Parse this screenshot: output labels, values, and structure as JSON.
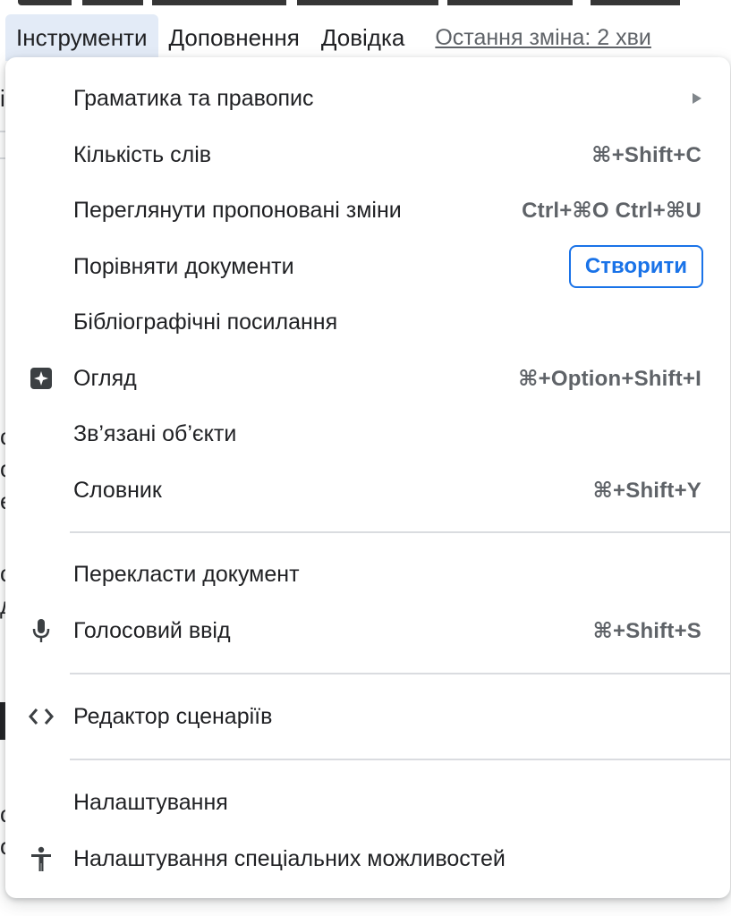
{
  "menubar": {
    "items": [
      {
        "label": "Інструменти",
        "active": true
      },
      {
        "label": "Доповнення",
        "active": false
      },
      {
        "label": "Довідка",
        "active": false
      }
    ],
    "last_edit": "Остання зміна: 2 хви"
  },
  "menu": {
    "items": [
      {
        "label": "Граматика та правопис",
        "shortcut": "",
        "icon": "",
        "submenu": true
      },
      {
        "label": "Кількість слів",
        "shortcut": "⌘+Shift+C",
        "icon": ""
      },
      {
        "label": "Переглянути пропоновані зміни",
        "shortcut": "Ctrl+⌘O Ctrl+⌘U",
        "icon": ""
      },
      {
        "label": "Порівняти документи",
        "shortcut": "",
        "icon": "",
        "button": "Створити"
      },
      {
        "label": "Бібліографічні посилання",
        "shortcut": "",
        "icon": ""
      },
      {
        "label": "Огляд",
        "shortcut": "⌘+Option+Shift+I",
        "icon": "explore-sparkle-icon"
      },
      {
        "label": "Зв’язані об’єкти",
        "shortcut": "",
        "icon": ""
      },
      {
        "label": "Словник",
        "shortcut": "⌘+Shift+Y",
        "icon": ""
      },
      {
        "label": "Перекласти документ",
        "shortcut": "",
        "icon": ""
      },
      {
        "label": "Голосовий ввід",
        "shortcut": "⌘+Shift+S",
        "icon": "microphone-icon"
      },
      {
        "label": "Редактор сценаріїв",
        "shortcut": "",
        "icon": "code-brackets-icon"
      },
      {
        "label": "Налаштування",
        "shortcut": "",
        "icon": ""
      },
      {
        "label": "Налаштування спеціальних можливостей",
        "shortcut": "",
        "icon": "accessibility-icon"
      }
    ]
  },
  "background_fragments": [
    "і",
    "с",
    "о",
    "е",
    "с",
    "д",
    "с",
    "о"
  ],
  "colors": {
    "accent": "#1a73e8",
    "menubar_active_bg": "#e3ebf7",
    "text": "#202124",
    "shortcut": "#5f6368",
    "separator": "#dadce0"
  }
}
